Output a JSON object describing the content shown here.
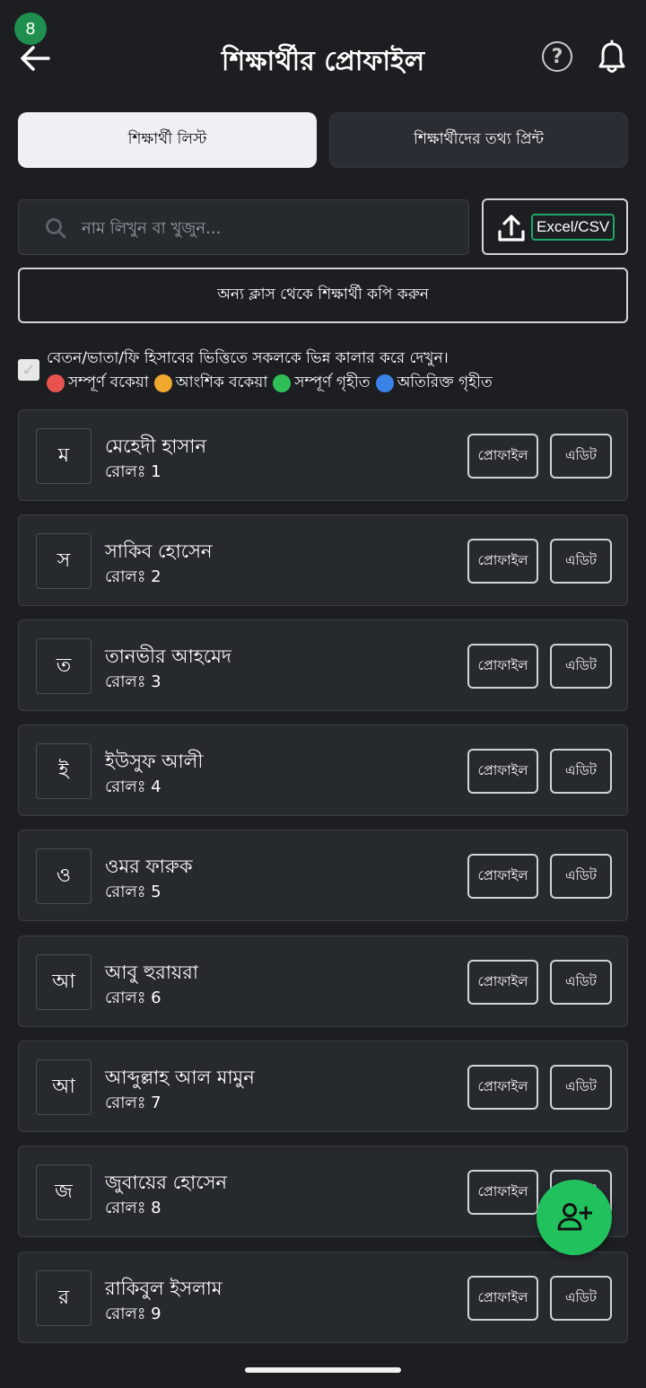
{
  "status": {
    "badge_count": "8"
  },
  "header": {
    "title": "শিক্ষার্থীর প্রোফাইল",
    "help_symbol": "?"
  },
  "tabs": [
    {
      "label": "শিক্ষার্থী লিস্ট",
      "active": true
    },
    {
      "label": "শিক্ষার্থীদের তথ্য প্রিন্ট",
      "active": false
    }
  ],
  "search": {
    "placeholder": "নাম লিখুন বা খুজুন...",
    "value": ""
  },
  "upload": {
    "label": "Excel/CSV"
  },
  "copy_button": {
    "label": "অন্য ক্লাস থেকে শিক্ষার্থী কপি করুন"
  },
  "color_toggle": {
    "checked": true,
    "check_symbol": "✓",
    "label": "বেতন/ভাতা/ফি হিসাবের ভিত্তিতে সকলকে ভিন্ন কালার করে দেখুন।"
  },
  "legend": [
    {
      "label": "সম্পূর্ণ বকেয়া",
      "color": "#e8534f"
    },
    {
      "label": "আংশিক বকেয়া",
      "color": "#f0a92e"
    },
    {
      "label": "সম্পূর্ণ গৃহীত",
      "color": "#2fbf57"
    },
    {
      "label": "অতিরিক্ত গৃহীত",
      "color": "#3b82e8"
    }
  ],
  "student_buttons": {
    "profile": "প্রোফাইল",
    "edit": "এডিট"
  },
  "students": [
    {
      "initial": "ম",
      "name": "মেহেদী হাসান",
      "roll": "রোলঃ 1"
    },
    {
      "initial": "স",
      "name": "সাকিব হোসেন",
      "roll": "রোলঃ 2"
    },
    {
      "initial": "ত",
      "name": "তানভীর আহমেদ",
      "roll": "রোলঃ 3"
    },
    {
      "initial": "ই",
      "name": "ইউসুফ আলী",
      "roll": "রোলঃ 4"
    },
    {
      "initial": "ও",
      "name": "ওমর ফারুক",
      "roll": "রোলঃ 5"
    },
    {
      "initial": "আ",
      "name": "আবু হুরায়রা",
      "roll": "রোলঃ 6"
    },
    {
      "initial": "আ",
      "name": "আব্দুল্লাহ আল মামুন",
      "roll": "রোলঃ 7"
    },
    {
      "initial": "জ",
      "name": "জুবায়ের হোসেন",
      "roll": "রোলঃ 8"
    },
    {
      "initial": "র",
      "name": "রাকিবুল ইসলাম",
      "roll": "রোলঃ 9"
    }
  ],
  "icons": {
    "back": "arrow-left-icon",
    "help": "help-circle-icon",
    "notifications": "bell-icon",
    "search": "search-icon",
    "upload": "upload-icon",
    "fab": "add-user-icon"
  },
  "colors": {
    "background": "#1c1e21",
    "card": "#26292e",
    "fab": "#21c25e",
    "badge": "#1e8f4e"
  }
}
